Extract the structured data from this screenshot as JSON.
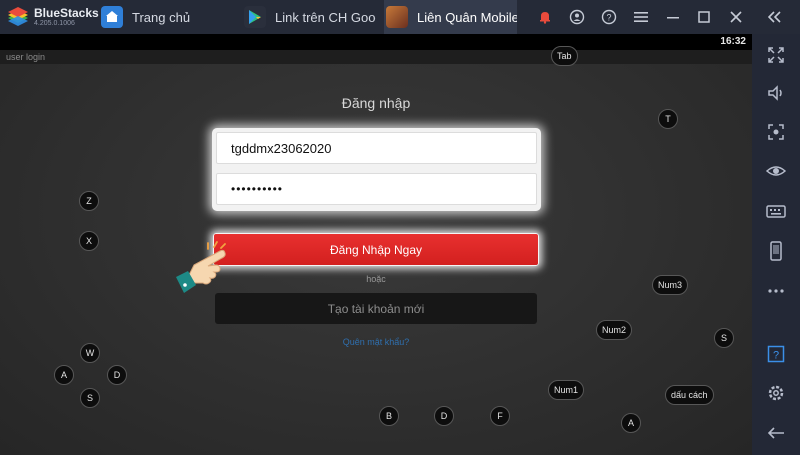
{
  "titlebar": {
    "brand": "BlueStacks",
    "version": "4.205.0.1006",
    "tabs": [
      {
        "label": "Trang chủ",
        "icon": "home-tab-icon"
      },
      {
        "label": "Link trên CH Google Play",
        "icon": "play-store-icon"
      },
      {
        "label": "Liên Quân Mobile",
        "icon": "game-icon"
      }
    ],
    "controls": [
      "notification-bell-icon",
      "account-icon",
      "help-icon",
      "menu-icon",
      "minimize-icon",
      "maximize-icon",
      "close-icon",
      "collapse-sidebar-icon"
    ]
  },
  "statusbar": {
    "time": "16:32"
  },
  "game": {
    "header_label": "user login",
    "login": {
      "title": "Đăng nhập",
      "username_value": "tgddmx23062020",
      "password_value": "••••••••••",
      "login_button": "Đăng Nhập Ngay",
      "or_text": "hoặc",
      "create_account_button": "Tạo tài khoản mới",
      "forgot_password": "Quên mật khẩu?"
    },
    "keymap": {
      "tab": "Tab",
      "t": "T",
      "z": "Z",
      "x": "X",
      "num3": "Num3",
      "num2": "Num2",
      "s_right": "S",
      "w": "W",
      "a": "A",
      "d": "D",
      "s_left": "S",
      "num1": "Num1",
      "space": "dấu cách",
      "b": "B",
      "d_bottom": "D",
      "f": "F",
      "a_bottom": "A"
    }
  },
  "sidebar": {
    "items": [
      "fullscreen-icon",
      "volume-icon",
      "screenshot-icon",
      "view-icon",
      "keyboard-icon",
      "phone-icon",
      "more-icon",
      "help-icon",
      "settings-icon",
      "back-icon"
    ]
  },
  "colors": {
    "accent_red": "#e02a29",
    "titlebar_bg": "#252a37",
    "sidebar_bg": "#232836"
  }
}
